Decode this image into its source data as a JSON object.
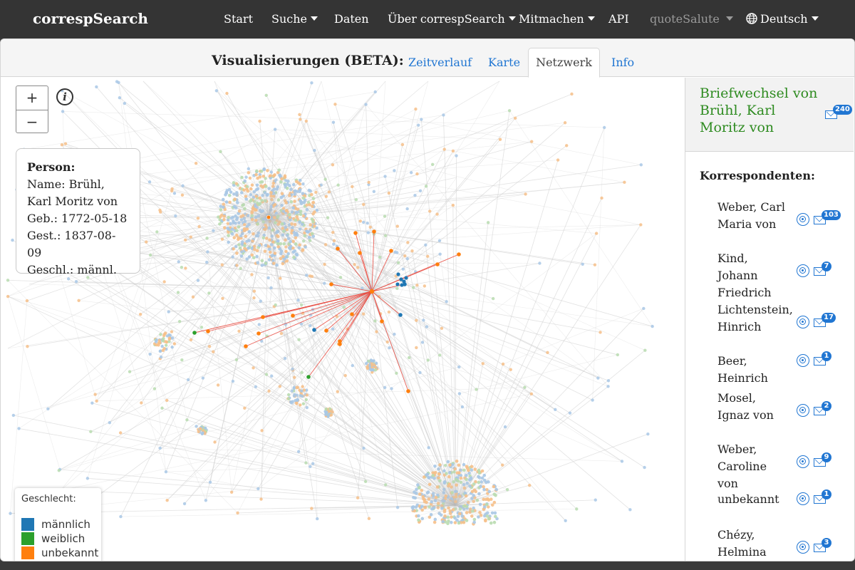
{
  "navbar": {
    "brand": "correspSearch",
    "items": [
      {
        "label": "Start",
        "dropdown": false
      },
      {
        "label": "Suche",
        "dropdown": true
      },
      {
        "label": "Daten",
        "dropdown": false
      },
      {
        "label": "Über correspSearch",
        "dropdown": true
      },
      {
        "label": "Mitmachen",
        "dropdown": true
      },
      {
        "label": "API",
        "dropdown": false
      },
      {
        "label": "quoteSalute",
        "dropdown": true,
        "muted": true
      },
      {
        "label": "Deutsch",
        "dropdown": true,
        "icon": "globe-icon"
      }
    ]
  },
  "visualisations": {
    "title": "Visualisierungen (BETA):",
    "tabs": [
      {
        "label": "Zeitverlauf",
        "active": false
      },
      {
        "label": "Karte",
        "active": false
      },
      {
        "label": "Netzwerk",
        "active": true
      },
      {
        "label": "Info",
        "active": false
      }
    ]
  },
  "graph": {
    "zoom_in": "+",
    "zoom_out": "−",
    "info_icon": "i",
    "person": {
      "heading": "Person:",
      "lines": [
        "Name: Brühl, Karl Moritz von",
        "Geb.: 1772-05-18",
        "Gest.: 1837-08-09",
        "Geschl.: männl."
      ]
    },
    "legend": {
      "title": "Geschlecht:",
      "items": [
        {
          "label": "männlich",
          "color": "#1f77b4"
        },
        {
          "label": "weiblich",
          "color": "#2ca02c"
        },
        {
          "label": "unbekannt",
          "color": "#ff7f0e"
        }
      ]
    },
    "colors": {
      "male": "#1f77b4",
      "female": "#2ca02c",
      "unknown": "#ff7f0e",
      "edge": "#cfcfcf",
      "highlight_edge": "#e8473c"
    }
  },
  "sidebar": {
    "title": "Briefwechsel von Brühl, Karl Moritz von",
    "title_count": "240",
    "korrespondenten_label": "Korrespondenten:",
    "correspondents": [
      {
        "name": "Weber, Carl Maria von",
        "count": "103"
      },
      {
        "name": "Kind, Johann Friedrich",
        "count": "7"
      },
      {
        "name": "Lichtenstein, Hinrich",
        "count": "17"
      },
      {
        "name": "Beer, Heinrich",
        "count": "1"
      },
      {
        "name": "Mosel, Ignaz von",
        "count": "2"
      },
      {
        "name": "Weber, Caroline von",
        "count": "9"
      },
      {
        "name": "unbekannt",
        "count": "1"
      },
      {
        "name": "Chézy, Helmina von",
        "count": "3"
      }
    ]
  }
}
